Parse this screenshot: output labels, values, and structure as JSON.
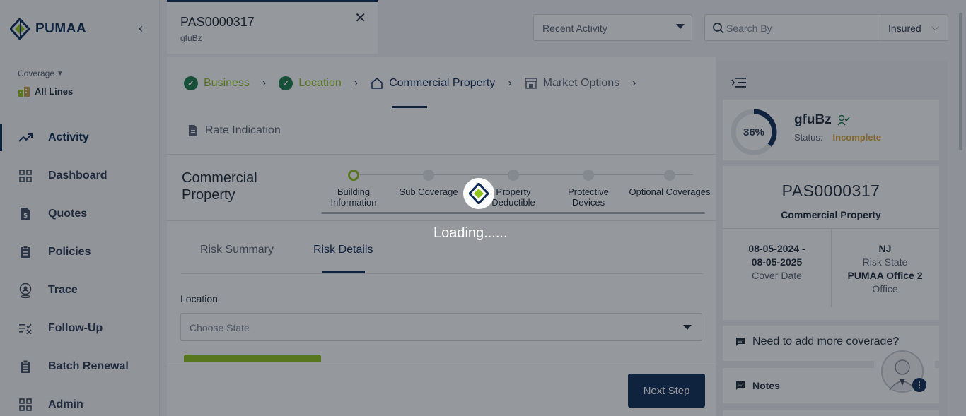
{
  "brand": {
    "name": "PUMAA"
  },
  "sidebar": {
    "coverage_label": "Coverage",
    "coverage_value": "All Lines",
    "items": [
      {
        "label": "Activity",
        "icon": "trending-up-icon",
        "active": true
      },
      {
        "label": "Dashboard",
        "icon": "grid-icon"
      },
      {
        "label": "Quotes",
        "icon": "quote-document-icon"
      },
      {
        "label": "Policies",
        "icon": "clipboard-icon"
      },
      {
        "label": "Trace",
        "icon": "location-pin-icon"
      },
      {
        "label": "Follow-Up",
        "icon": "checklist-icon"
      },
      {
        "label": "Batch Renewal",
        "icon": "clipboard-list-icon"
      },
      {
        "label": "Admin",
        "icon": "grid-icon"
      }
    ]
  },
  "tab": {
    "id": "PAS0000317",
    "sub": "gfuBz"
  },
  "header": {
    "recent_activity": "Recent Activity",
    "search_placeholder": "Search By",
    "search_type": "Insured"
  },
  "steps": {
    "business": "Business",
    "location": "Location",
    "commercial_property": "Commercial Property",
    "market_options": "Market Options",
    "rate_indication": "Rate Indication"
  },
  "section": {
    "title": "Commercial Property",
    "substeps": {
      "building_1": "Building",
      "building_2": "Information",
      "sub_coverage": "Sub Coverage",
      "property_1": "Property",
      "property_2": "Deductible",
      "protective_1": "Protective",
      "protective_2": "Devices",
      "optional": "Optional Coverages"
    },
    "tabs": {
      "risk_summary": "Risk Summary",
      "risk_details": "Risk Details"
    },
    "location_label": "Location",
    "state_placeholder": "Choose State"
  },
  "footer": {
    "next_step": "Next Step"
  },
  "insured": {
    "progress_text": "36%",
    "progress": 0.36,
    "name": "gfuBz",
    "status_label": "Status:",
    "status_value": "Incomplete"
  },
  "policy": {
    "id": "PAS0000317",
    "type": "Commercial Property",
    "date_from": "08-05-2024 -",
    "date_to": "08-05-2025",
    "cover_date_label": "Cover Date",
    "state": "NJ",
    "risk_state_label": "Risk State",
    "office": "PUMAA Office 2",
    "office_label": "Office"
  },
  "more_coverage": "Need to add more coverage?",
  "notes": "Notes",
  "loading": "Loading......",
  "colors": {
    "primary": "#0d2a55",
    "accent": "#8fc21a",
    "status": "#e0a33a"
  }
}
